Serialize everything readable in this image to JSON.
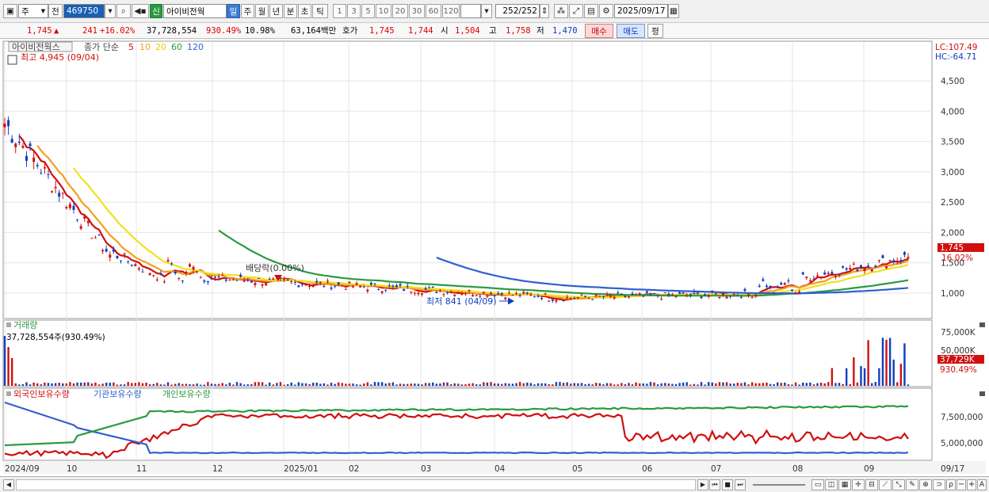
{
  "toolbar": {
    "period_select": "주",
    "prev_label": "전",
    "stock_code": "469750",
    "new_badge": "신",
    "stock_name": "아이비전웍",
    "period_tabs": [
      "일",
      "주",
      "월",
      "년",
      "분",
      "초",
      "틱"
    ],
    "active_tab": "일",
    "minute_options": [
      "1",
      "3",
      "5",
      "10",
      "20",
      "30",
      "60",
      "120"
    ],
    "count_current": "252",
    "count_total": "/252",
    "date": "2025/09/17"
  },
  "quote": {
    "price": "1,745",
    "change": "241",
    "change_pct": "+16.02%",
    "volume": "37,728,554",
    "volume_ratio": "930.49%",
    "turnover": "10.98%",
    "amount": "63,164백만",
    "bid_label": "호가",
    "ask": "1,745",
    "bid": "1,744",
    "open_label": "시",
    "open": "1,504",
    "high_label": "고",
    "high": "1,758",
    "low_label": "저",
    "low": "1,470",
    "buy_button": "매수",
    "sell_button": "매도",
    "eval_button": "평"
  },
  "price_panel": {
    "stock_label": "아이비전웍스",
    "ma_label": "종가 단순",
    "ma_periods": [
      "5",
      "10",
      "20",
      "60",
      "120"
    ],
    "ma_colors": [
      "#d01010",
      "#f0a020",
      "#f0e020",
      "#2a9a40",
      "#3060d0"
    ],
    "high_note": "최고 4,945 (09/04)",
    "low_note": "최저 841 (04/09)",
    "dividend_note": "배당락(0.00%)",
    "lc": "LC:107.49",
    "hc": "HC:-64.71",
    "y_ticks": [
      "4,500",
      "4,000",
      "3,500",
      "3,000",
      "2,500",
      "2,000",
      "1,500",
      "1,000"
    ],
    "y_values": [
      4500,
      4000,
      3500,
      3000,
      2500,
      2000,
      1500,
      1000
    ],
    "last_price_tag": "1,745",
    "last_pct_tag": "16.02%"
  },
  "volume_panel": {
    "title": "거래량",
    "note": "37,728,554주(930.49%)",
    "y_ticks": [
      "75,000K",
      "50,000K"
    ],
    "last_tag": "37,729K",
    "last_pct": "930.49%"
  },
  "holding_panel": {
    "series": [
      "외국인보유수량",
      "기관보유수량",
      "개인보유수량"
    ],
    "colors": [
      "#d01010",
      "#3060d0",
      "#2a9a40"
    ],
    "y_ticks": [
      "7,500,000",
      "5,000,000"
    ]
  },
  "x_axis": {
    "labels": [
      "2024/09",
      "10",
      "11",
      "12",
      "2025/01",
      "02",
      "03",
      "04",
      "05",
      "06",
      "07",
      "08",
      "09"
    ],
    "end_label": "09/17"
  }
}
